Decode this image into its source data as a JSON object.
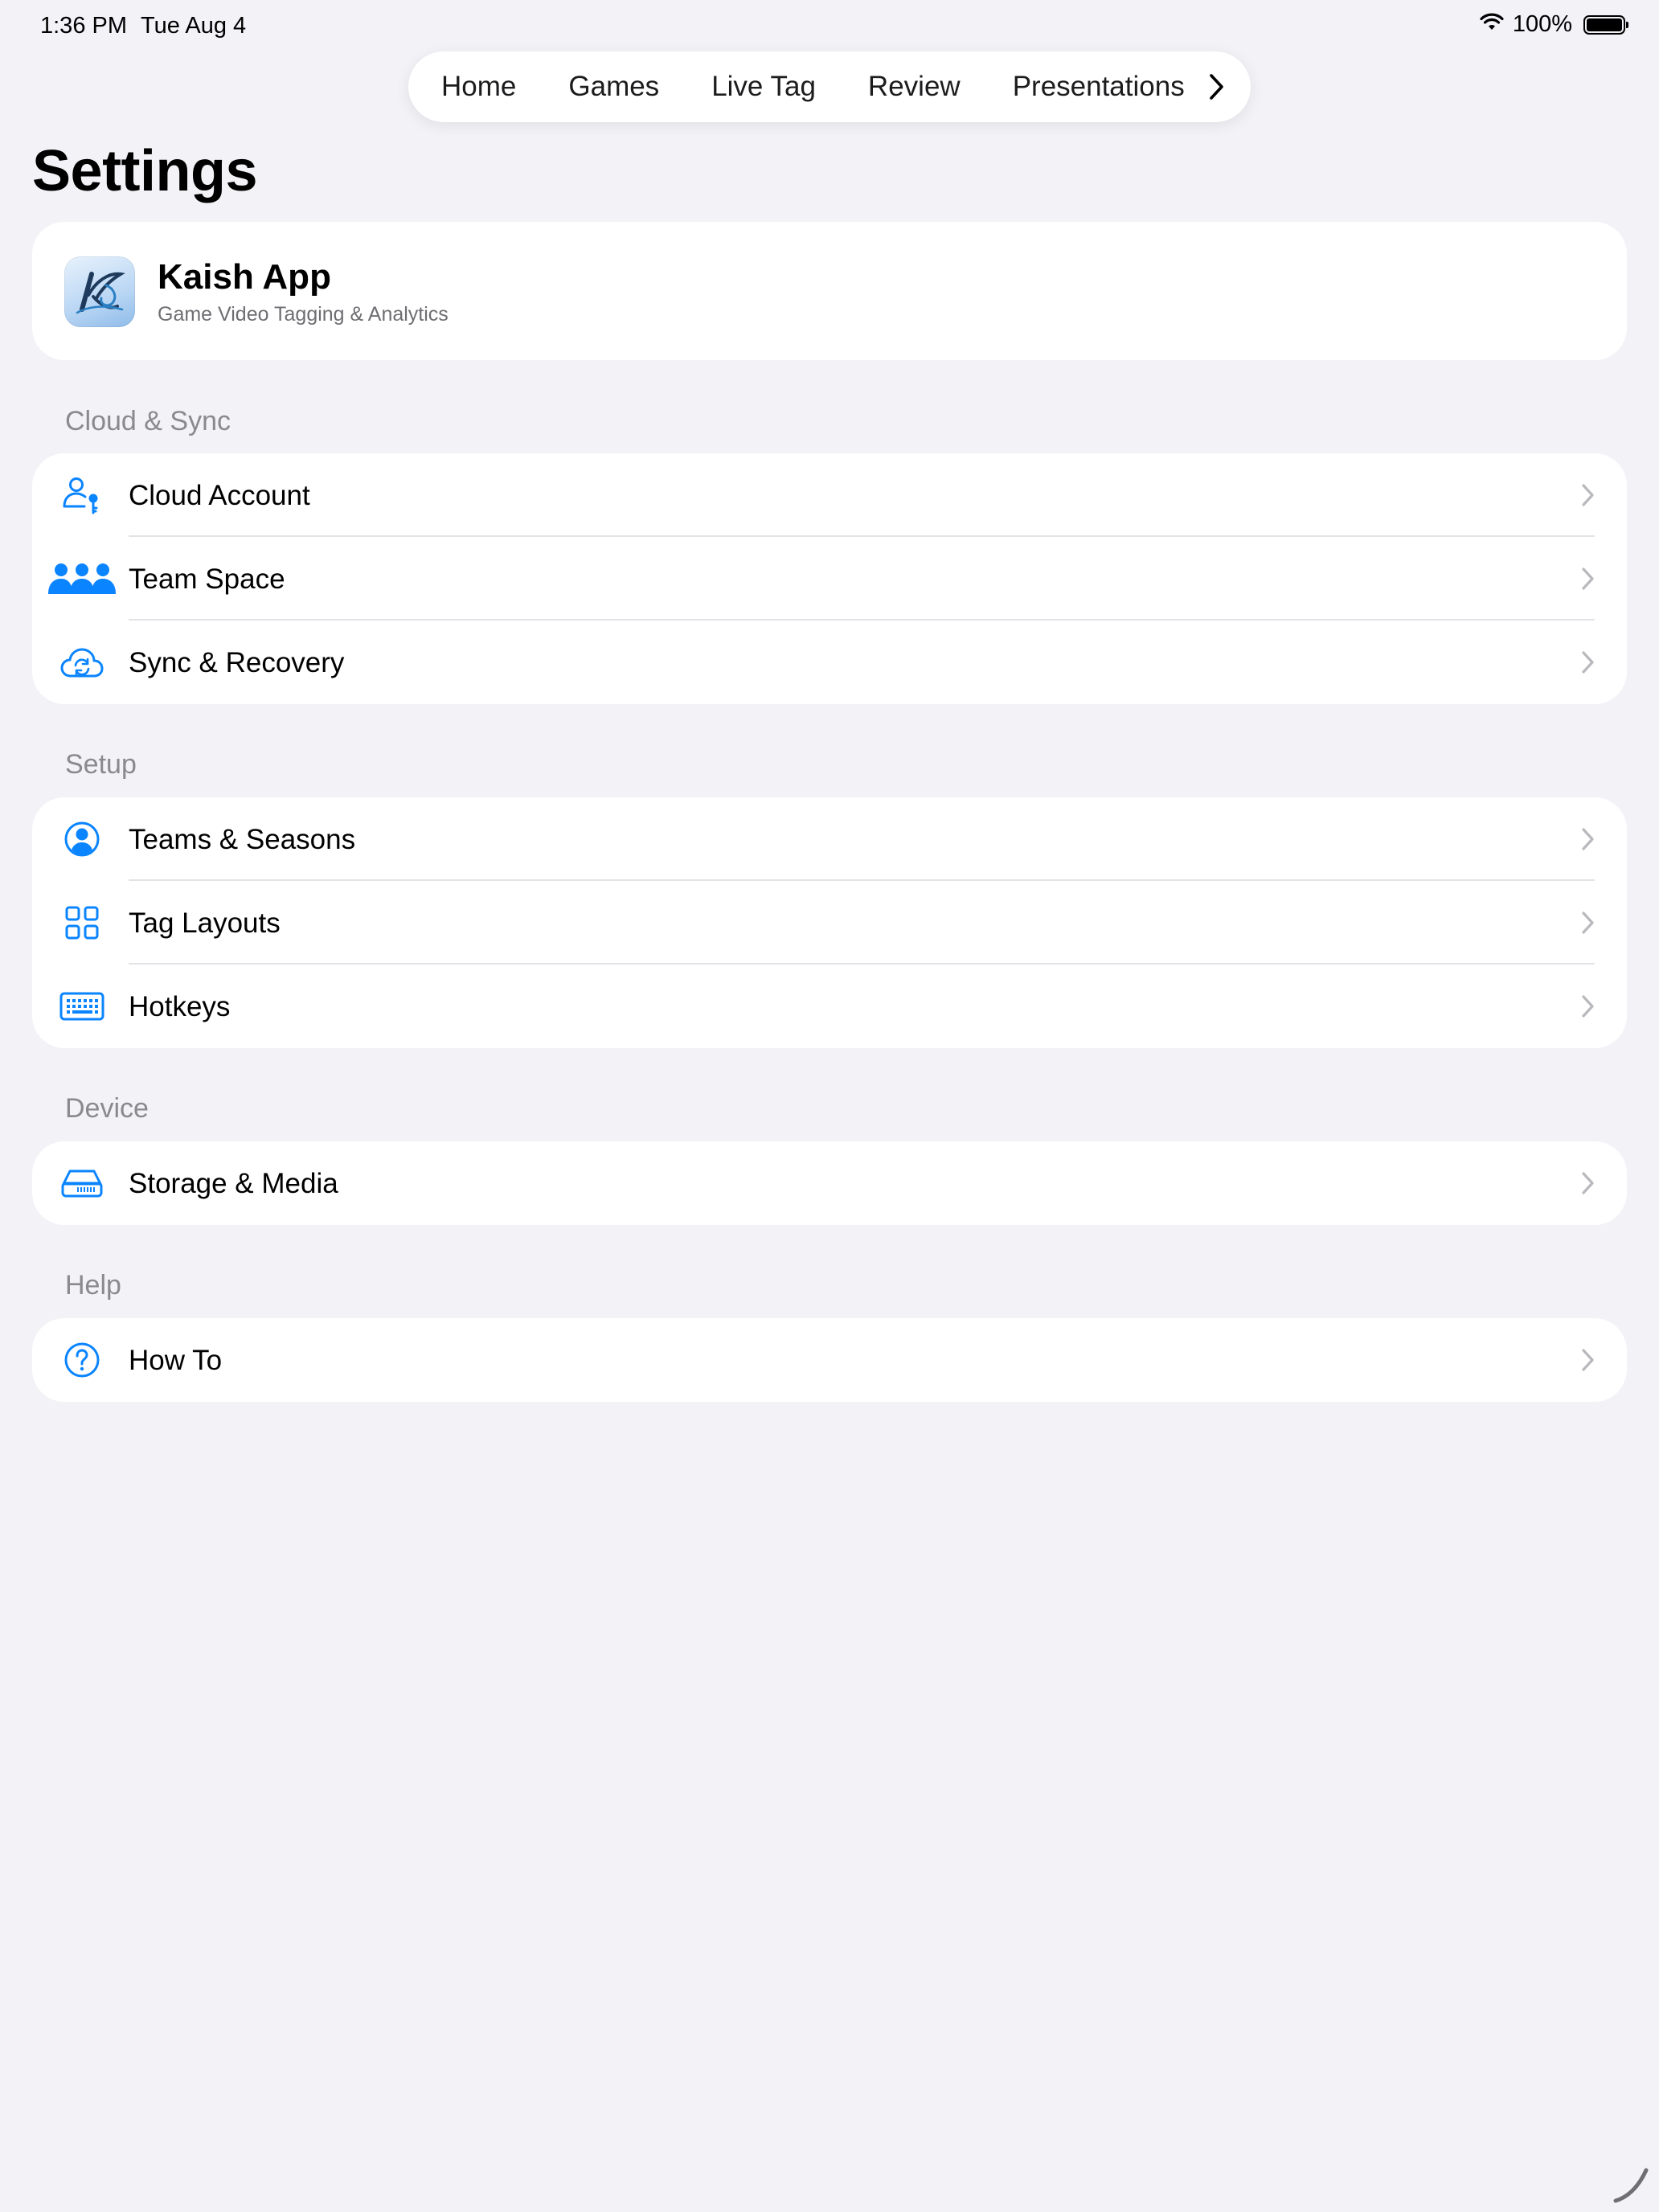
{
  "status_bar": {
    "time": "1:36 PM",
    "date": "Tue Aug 4",
    "battery": "100%"
  },
  "tabs": [
    {
      "label": "Home"
    },
    {
      "label": "Games"
    },
    {
      "label": "Live Tag"
    },
    {
      "label": "Review"
    },
    {
      "label": "Presentations"
    }
  ],
  "page_title": "Settings",
  "app_card": {
    "name": "Kaish App",
    "subtitle": "Game Video Tagging & Analytics"
  },
  "sections": [
    {
      "header": "Cloud & Sync",
      "items": [
        {
          "label": "Cloud Account",
          "icon": "person-key-icon"
        },
        {
          "label": "Team Space",
          "icon": "people-icon"
        },
        {
          "label": "Sync & Recovery",
          "icon": "cloud-sync-icon"
        }
      ]
    },
    {
      "header": "Setup",
      "items": [
        {
          "label": "Teams & Seasons",
          "icon": "person-circle-icon"
        },
        {
          "label": "Tag Layouts",
          "icon": "grid-icon"
        },
        {
          "label": "Hotkeys",
          "icon": "keyboard-icon"
        }
      ]
    },
    {
      "header": "Device",
      "items": [
        {
          "label": "Storage & Media",
          "icon": "drive-icon"
        }
      ]
    },
    {
      "header": "Help",
      "items": [
        {
          "label": "How To",
          "icon": "question-circle-icon"
        }
      ]
    }
  ],
  "colors": {
    "accent": "#0a84ff",
    "background": "#f2f2f7",
    "secondary_text": "#8a8a8e",
    "chevron": "#b8b8bd"
  }
}
